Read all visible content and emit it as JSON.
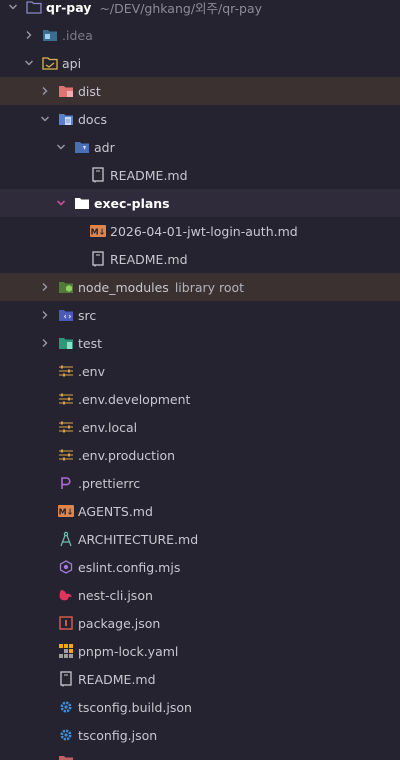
{
  "project": {
    "name": "qr-pay",
    "path": "~/DEV/ghkang/외주/qr-pay"
  },
  "colors": {
    "background": "#25232f",
    "excluded_highlight": "#3a3130",
    "focus_highlight": "#2f2b3a",
    "chevron": "#9a97a6",
    "folder": "#6b67a8",
    "markdown": "#e0854a",
    "env": "#d9a34a"
  },
  "tree": {
    "items": [
      {
        "label": "qr-pay",
        "hint": "~/DEV/ghkang/외주/qr-pay",
        "icon": "folder-icon"
      },
      {
        "label": ".idea",
        "icon": "idea-folder-icon"
      },
      {
        "label": "api",
        "icon": "folder-open-icon"
      },
      {
        "label": "dist",
        "icon": "excluded-folder-icon"
      },
      {
        "label": "docs",
        "icon": "docs-folder-icon"
      },
      {
        "label": "adr",
        "icon": "adr-folder-icon"
      },
      {
        "label": "README.md",
        "icon": "readme-icon"
      },
      {
        "label": "exec-plans",
        "icon": "white-folder-icon"
      },
      {
        "label": "2026-04-01-jwt-login-auth.md",
        "icon": "markdown-icon"
      },
      {
        "label": "README.md",
        "icon": "readme-icon"
      },
      {
        "label": "node_modules",
        "hint": "library root",
        "icon": "node-folder-icon"
      },
      {
        "label": "src",
        "icon": "src-folder-icon"
      },
      {
        "label": "test",
        "icon": "test-folder-icon"
      },
      {
        "label": ".env",
        "icon": "env-icon"
      },
      {
        "label": ".env.development",
        "icon": "env-icon"
      },
      {
        "label": ".env.local",
        "icon": "env-icon"
      },
      {
        "label": ".env.production",
        "icon": "env-icon"
      },
      {
        "label": ".prettierrc",
        "icon": "prettier-icon"
      },
      {
        "label": "AGENTS.md",
        "icon": "markdown-icon"
      },
      {
        "label": "ARCHITECTURE.md",
        "icon": "compass-icon"
      },
      {
        "label": "eslint.config.mjs",
        "icon": "eslint-icon"
      },
      {
        "label": "nest-cli.json",
        "icon": "nest-icon"
      },
      {
        "label": "package.json",
        "icon": "package-icon"
      },
      {
        "label": "pnpm-lock.yaml",
        "icon": "pnpm-icon"
      },
      {
        "label": "README.md",
        "icon": "readme-icon"
      },
      {
        "label": "tsconfig.build.json",
        "icon": "tsconfig-icon"
      },
      {
        "label": "tsconfig.json",
        "icon": "tsconfig-icon"
      }
    ]
  }
}
